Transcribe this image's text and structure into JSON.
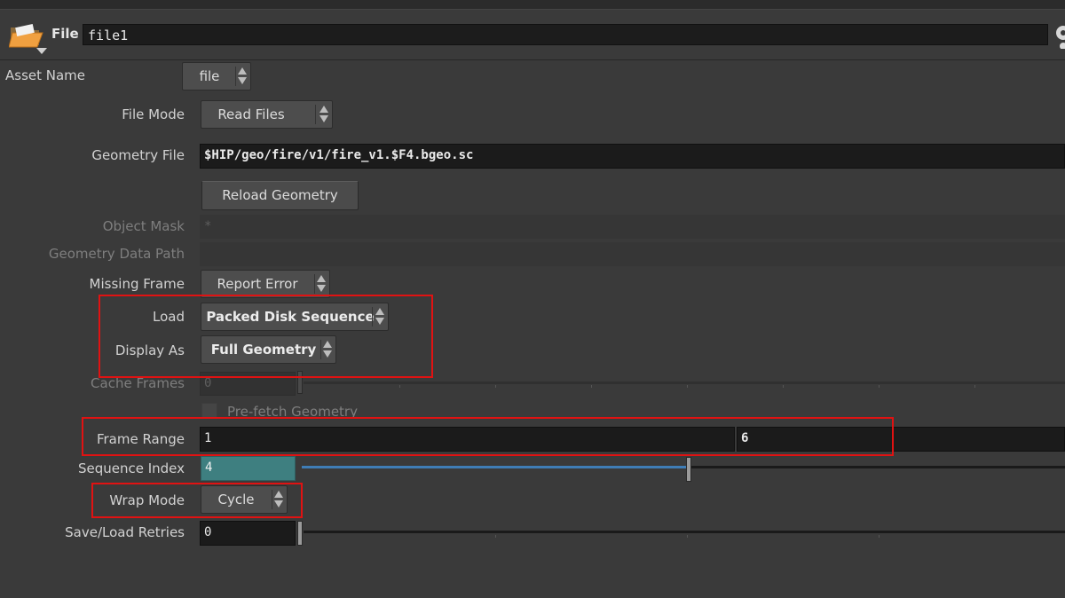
{
  "header": {
    "type_label": "File",
    "node_name": "file1",
    "icon": "folder-icon",
    "settings_icon": "gear-icon"
  },
  "params": {
    "asset_name": {
      "label": "Asset Name",
      "value": "file"
    },
    "file_mode": {
      "label": "File Mode",
      "value": "Read Files"
    },
    "geometry_file": {
      "label": "Geometry File",
      "value": "$HIP/geo/fire/v1/fire_v1.$F4.bgeo.sc"
    },
    "reload_button": "Reload Geometry",
    "object_mask": {
      "label": "Object Mask",
      "value": "*"
    },
    "geometry_data_path": {
      "label": "Geometry Data Path",
      "value": ""
    },
    "missing_frame": {
      "label": "Missing Frame",
      "value": "Report Error"
    },
    "load": {
      "label": "Load",
      "value": "Packed Disk Sequence"
    },
    "display_as": {
      "label": "Display As",
      "value": "Full Geometry"
    },
    "cache_frames": {
      "label": "Cache Frames",
      "value": "0"
    },
    "prefetch_geometry": {
      "label": "Pre-fetch Geometry",
      "checked": false
    },
    "frame_range": {
      "label": "Frame Range",
      "start": "1",
      "end": "6"
    },
    "sequence_index": {
      "label": "Sequence Index",
      "value": "4",
      "slider_fraction": 0.5
    },
    "wrap_mode": {
      "label": "Wrap Mode",
      "value": "Cycle"
    },
    "save_load_retries": {
      "label": "Save/Load Retries",
      "value": "0"
    }
  },
  "colors": {
    "highlight": "#e01212",
    "active_field": "#3e7f80",
    "slider_fill": "#3f7db6"
  }
}
